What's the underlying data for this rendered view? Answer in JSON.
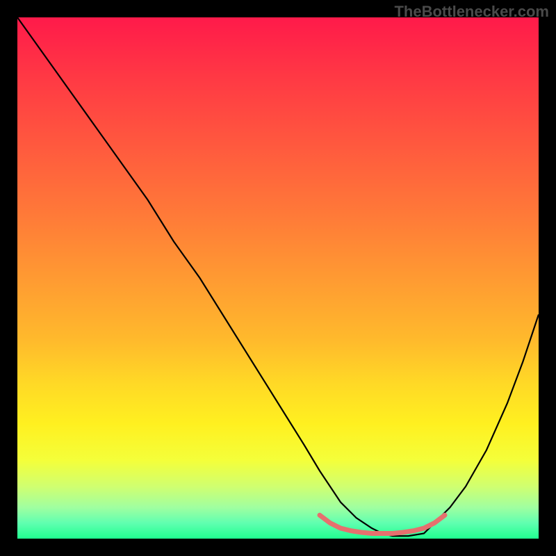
{
  "watermark": "TheBottlenecker.com",
  "chart_data": {
    "type": "line",
    "title": "",
    "xlabel": "",
    "ylabel": "",
    "xlim": [
      0,
      100
    ],
    "ylim": [
      0,
      100
    ],
    "background": {
      "type": "vertical-gradient",
      "stops": [
        {
          "offset": 0,
          "color": "#ff1a4a"
        },
        {
          "offset": 12,
          "color": "#ff3a44"
        },
        {
          "offset": 25,
          "color": "#ff5a3e"
        },
        {
          "offset": 38,
          "color": "#ff7a38"
        },
        {
          "offset": 50,
          "color": "#ff9a32"
        },
        {
          "offset": 62,
          "color": "#ffba2c"
        },
        {
          "offset": 70,
          "color": "#ffd826"
        },
        {
          "offset": 78,
          "color": "#fff020"
        },
        {
          "offset": 85,
          "color": "#f4ff3a"
        },
        {
          "offset": 90,
          "color": "#d0ff70"
        },
        {
          "offset": 94,
          "color": "#a0ffa0"
        },
        {
          "offset": 97,
          "color": "#60ffb0"
        },
        {
          "offset": 100,
          "color": "#20ff90"
        }
      ]
    },
    "series": [
      {
        "name": "curve",
        "color": "#000000",
        "width": 2.2,
        "x": [
          0,
          5,
          10,
          15,
          20,
          25,
          30,
          35,
          40,
          45,
          50,
          55,
          58,
          60,
          62,
          65,
          68,
          70,
          72,
          75,
          78,
          80,
          83,
          86,
          90,
          94,
          97,
          100
        ],
        "y": [
          100,
          93,
          86,
          79,
          72,
          65,
          57,
          50,
          42,
          34,
          26,
          18,
          13,
          10,
          7,
          4,
          2,
          1,
          0.5,
          0.5,
          1,
          3,
          6,
          10,
          17,
          26,
          34,
          43
        ]
      },
      {
        "name": "optimal-band",
        "color": "#e6706e",
        "width": 7,
        "x": [
          58,
          60,
          62,
          64,
          66,
          68,
          70,
          72,
          74,
          76,
          78,
          80,
          82
        ],
        "y": [
          4.5,
          3.0,
          2.0,
          1.5,
          1.2,
          1.0,
          1.0,
          1.0,
          1.2,
          1.5,
          2.0,
          3.0,
          4.5
        ]
      }
    ]
  }
}
